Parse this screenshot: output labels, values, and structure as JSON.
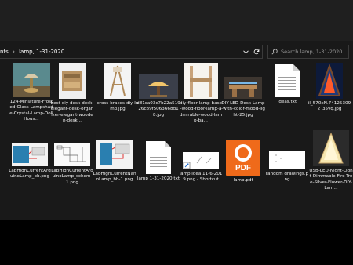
{
  "address": {
    "parts": [
      "nts",
      "lamp, 1-31-2020"
    ],
    "dropdown_icon": "chevron-down-icon",
    "refresh_icon": "refresh-icon"
  },
  "search": {
    "placeholder": "Search lamp, 1-31-2020",
    "icon": "search-icon"
  },
  "files": [
    {
      "name": "124-Miniature-Frosted-Glass-Lampshade-Crystal-Lamp-DollHous...",
      "kind": "image"
    },
    {
      "name": "best-diy-desk-desk-elegant-desk-organizer-elegant-wooden-desk...",
      "kind": "image"
    },
    {
      "name": "cross-braces-diy-lamp.jpg",
      "kind": "image"
    },
    {
      "name": "d81ca03c7b22a51926c89f5063668d18.jpg",
      "kind": "image"
    },
    {
      "name": "diy-floor-lamp-base-wood-floor-lamp-admirable-wood-lamp-ba...",
      "kind": "image"
    },
    {
      "name": "DIY-LED-Desk-Lamp-with-color-mood-light-25.jpg",
      "kind": "image"
    },
    {
      "name": "ideas.txt",
      "kind": "text"
    },
    {
      "name": "il_570xN.741253092_35vq.jpg",
      "kind": "image"
    },
    {
      "name": "LabHighCurrentArduinoLamp_bb.png",
      "kind": "image"
    },
    {
      "name": "LabHighCurrentArduinoLamp_schem-1.png",
      "kind": "image"
    },
    {
      "name": "LabHighCurrentNanoLamp_bb-1.png",
      "kind": "image"
    },
    {
      "name": "lamp 1-31-2020.txt",
      "kind": "text"
    },
    {
      "name": "lamp idea 11-6-2019.png - Shortcut",
      "kind": "shortcut"
    },
    {
      "name": "lamp.pdf",
      "kind": "pdf"
    },
    {
      "name": "random drawings.png",
      "kind": "image"
    },
    {
      "name": "USB-LED-Night-Light-Dimmable-Fire-Tree-Silver-Flower-DIY-Lam...",
      "kind": "image"
    }
  ],
  "pdf_icon_label": "PDF",
  "colors": {
    "window_bg": "#191919",
    "pdf_orange": "#ef6a1a",
    "border": "#3a3a3a"
  }
}
